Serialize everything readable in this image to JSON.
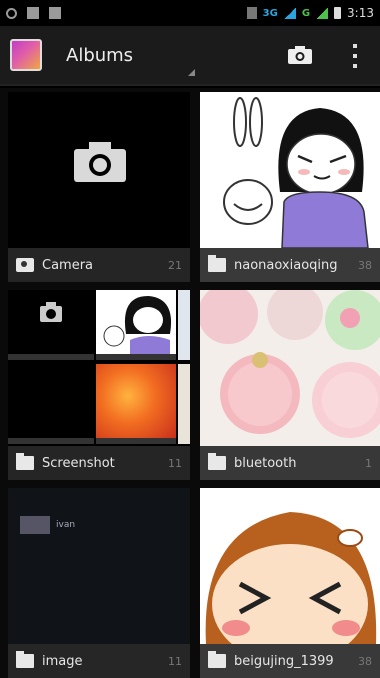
{
  "status_bar": {
    "time": "3:13",
    "network": "3G",
    "network2": "G"
  },
  "action_bar": {
    "title": "Albums"
  },
  "albums": [
    {
      "name": "Camera",
      "count": "21"
    },
    {
      "name": "naonaoxiaoqing",
      "count": "38"
    },
    {
      "name": "Screenshot",
      "count": "11"
    },
    {
      "name": "bluetooth",
      "count": "1"
    },
    {
      "name": "image",
      "count": "11"
    },
    {
      "name": "beigujing_1399",
      "count": "38"
    }
  ],
  "image_tile": {
    "inner_label": "ivan"
  },
  "icons": {
    "app": "gallery-app-icon",
    "camera": "camera-icon",
    "overflow": "overflow-menu-icon",
    "folder": "folder-icon"
  }
}
